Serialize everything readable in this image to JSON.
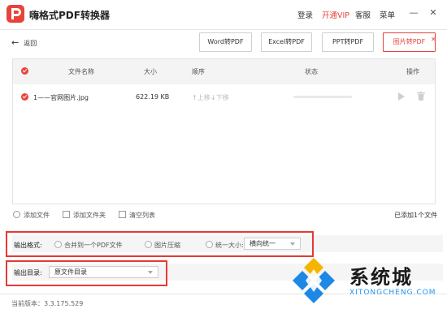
{
  "app": {
    "title": "嗨格式PDF转换器",
    "menu": {
      "login": "登录",
      "vip": "开通VIP",
      "service": "客服",
      "menu": "菜单"
    },
    "window_controls": {
      "minimize": "—",
      "close": "✕"
    }
  },
  "nav": {
    "back": "返回",
    "tabs": [
      "Word转PDF",
      "Excel转PDF",
      "PPT转PDF",
      "图片转PDF"
    ],
    "active_tab": "图片转PDF"
  },
  "table": {
    "headers": {
      "name": "文件名称",
      "size": "大小",
      "order": "顺序",
      "status": "状态",
      "action": "操作"
    },
    "rows": [
      {
        "name": "1——官网图片.jpg",
        "size": "622.19 KB",
        "move_up": "上移",
        "move_down": "下移",
        "progress": 0
      }
    ]
  },
  "toolbar": {
    "add_file": "添加文件",
    "add_folder": "添加文件夹",
    "clear": "清空列表",
    "count": "已添加1个文件"
  },
  "output_format": {
    "label": "输出格式:",
    "options": [
      "合并到一个PDF文件",
      "图片压缩",
      "统一大小:"
    ],
    "size_select": "横向统一"
  },
  "output_dir": {
    "label": "输出目录:",
    "value": "原文件目录"
  },
  "footer": {
    "version": "当前版本：3.3.175.529"
  },
  "watermark": {
    "text": "系统城",
    "sub": "XITONGCHENG.COM"
  },
  "colors": {
    "accent": "#e8433b",
    "highlight_box": "#e53935",
    "watermark_blue": "#2196f3"
  }
}
